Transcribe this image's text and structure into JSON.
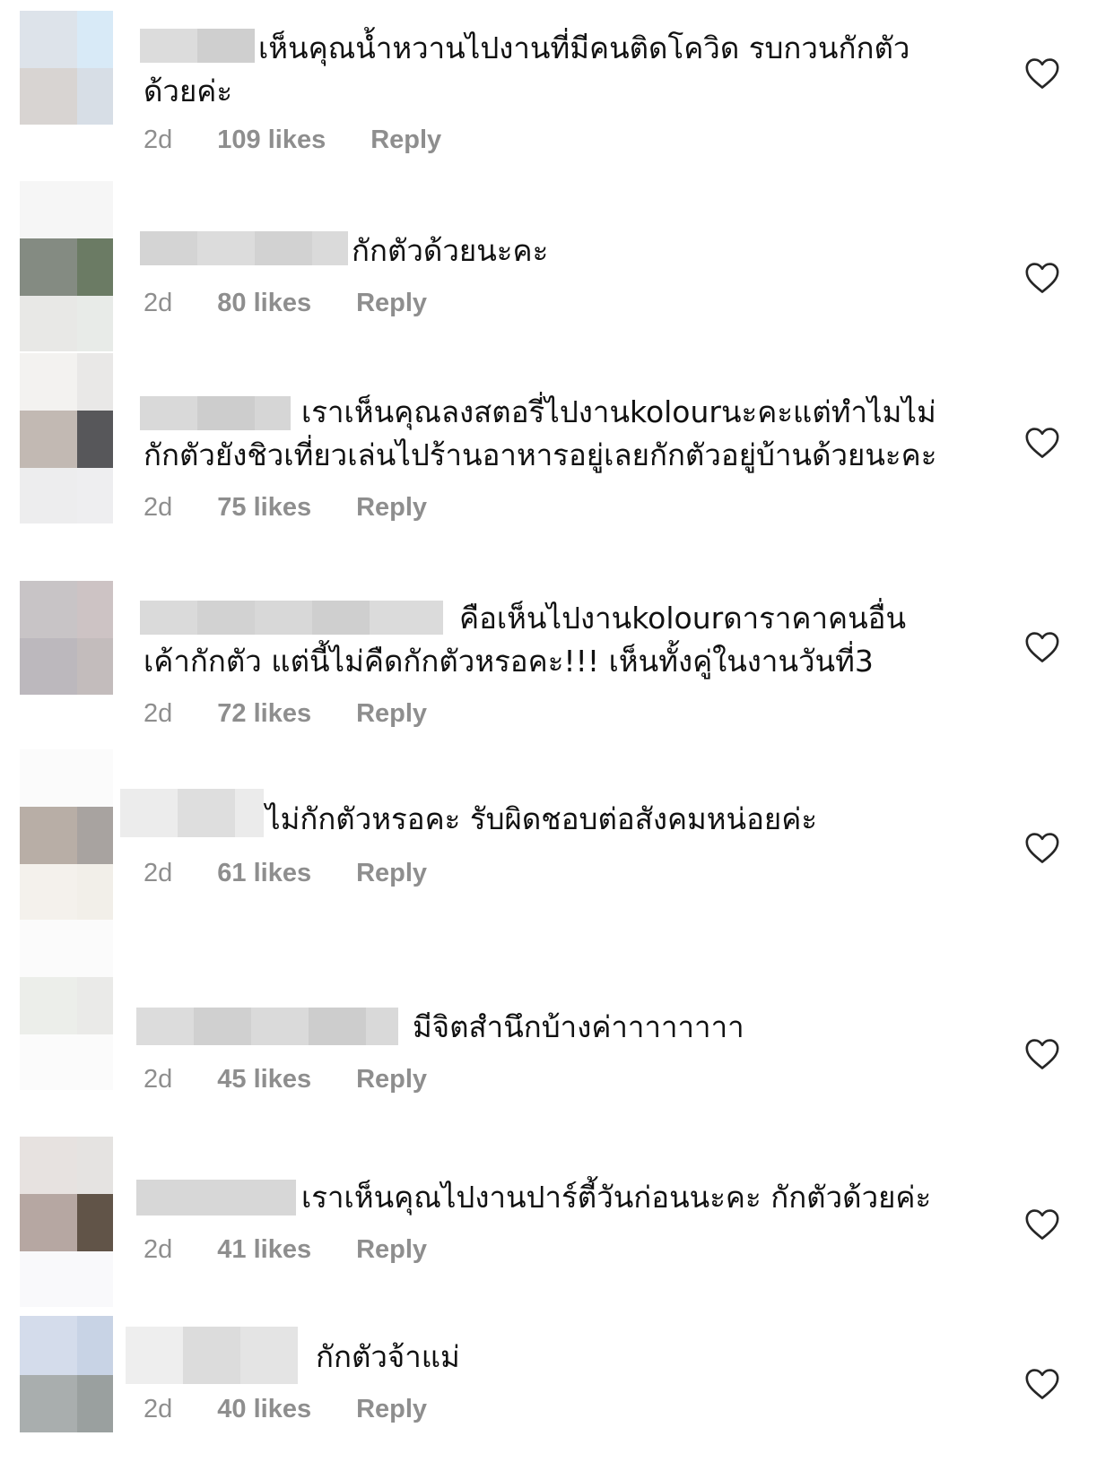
{
  "comments": [
    {
      "text": "เห็นคุณน้ำหวานไปงานที่มีคนติดโควิด รบกวนกักตัวด้วยค่ะ",
      "time": "2d",
      "likes": "109 likes",
      "reply": "Reply",
      "avatar_colors": [
        "#dde3ea",
        "#d8eaf7",
        "#d8d4d2",
        "#d7dee6"
      ]
    },
    {
      "text": "กักตัวด้วยนะคะ",
      "time": "2d",
      "likes": "80 likes",
      "reply": "Reply",
      "avatar_colors": [
        "#f6f6f6",
        "#f6f6f6",
        "#848b82",
        "#6b7b64",
        "#e8e8e6",
        "#e8ebe8"
      ]
    },
    {
      "text": "เราเห็นคุณลงสตอรี่ไปงานkolourนะคะแต่ทำไมไม่กักตัวยังชิวเที่ยวเล่นไปร้านอาหารอยู่เลยกักตัวอยู่บ้านด้วยนะคะ",
      "time": "2d",
      "likes": "75 likes",
      "reply": "Reply",
      "avatar_colors": [
        "#f3f2f0",
        "#e9e8e7",
        "#c2b9b3",
        "#57575a",
        "#ededee",
        "#eeeef0"
      ]
    },
    {
      "text": "คือเห็นไปงานkolourดาราคาคนอื่นเค้ากักตัว แต่นี้ไม่คืดกักตัวหรอคะ!!! เห็นทั้งคู่ในงานวันที่3",
      "time": "2d",
      "likes": "72 likes",
      "reply": "Reply",
      "avatar_colors": [
        "#c8c4c6",
        "#cdc3c4",
        "#bcb8bd",
        "#c3bcbc"
      ]
    },
    {
      "text": "ไม่กักตัวหรอคะ รับผิดชอบต่อสังคมหน่อยค่ะ",
      "time": "2d",
      "likes": "61 likes",
      "reply": "Reply",
      "avatar_colors": [
        "#fbfbfb",
        "#fbfbfb",
        "#b8aea6",
        "#a8a3a0",
        "#f4f1ec",
        "#f2efe9"
      ]
    },
    {
      "text": "มีจิตสำนึกบ้างค่าาาาาาาา",
      "time": "2d",
      "likes": "45 likes",
      "reply": "Reply",
      "avatar_colors": [
        "#fbfbfb",
        "#fbfbfb",
        "#eceeea",
        "#eaeae8",
        "#fbfbfb",
        "#fbfbfb"
      ]
    },
    {
      "text": "เราเห็นคุณไปงานปาร์ตี้วันก่อนนะคะ กักตัวด้วยค่ะ",
      "time": "2d",
      "likes": "41 likes",
      "reply": "Reply",
      "avatar_colors": [
        "#e7e2e0",
        "#e5e3e1",
        "#b6a7a2",
        "#615448",
        "#f9f9fb",
        "#f9f9fb"
      ]
    },
    {
      "text": "กักตัวจ้าแม่",
      "time": "2d",
      "likes": "40 likes",
      "reply": "Reply",
      "avatar_colors": [
        "#d4dceb",
        "#c8d3e5",
        "#a9aeae",
        "#9aa09f"
      ]
    }
  ],
  "colors": {
    "meta_text": "#8e8e8e",
    "heart_stroke": "#262626",
    "username_blur": "#d6d6d6"
  },
  "icons": {
    "like": "heart-outline-icon"
  }
}
